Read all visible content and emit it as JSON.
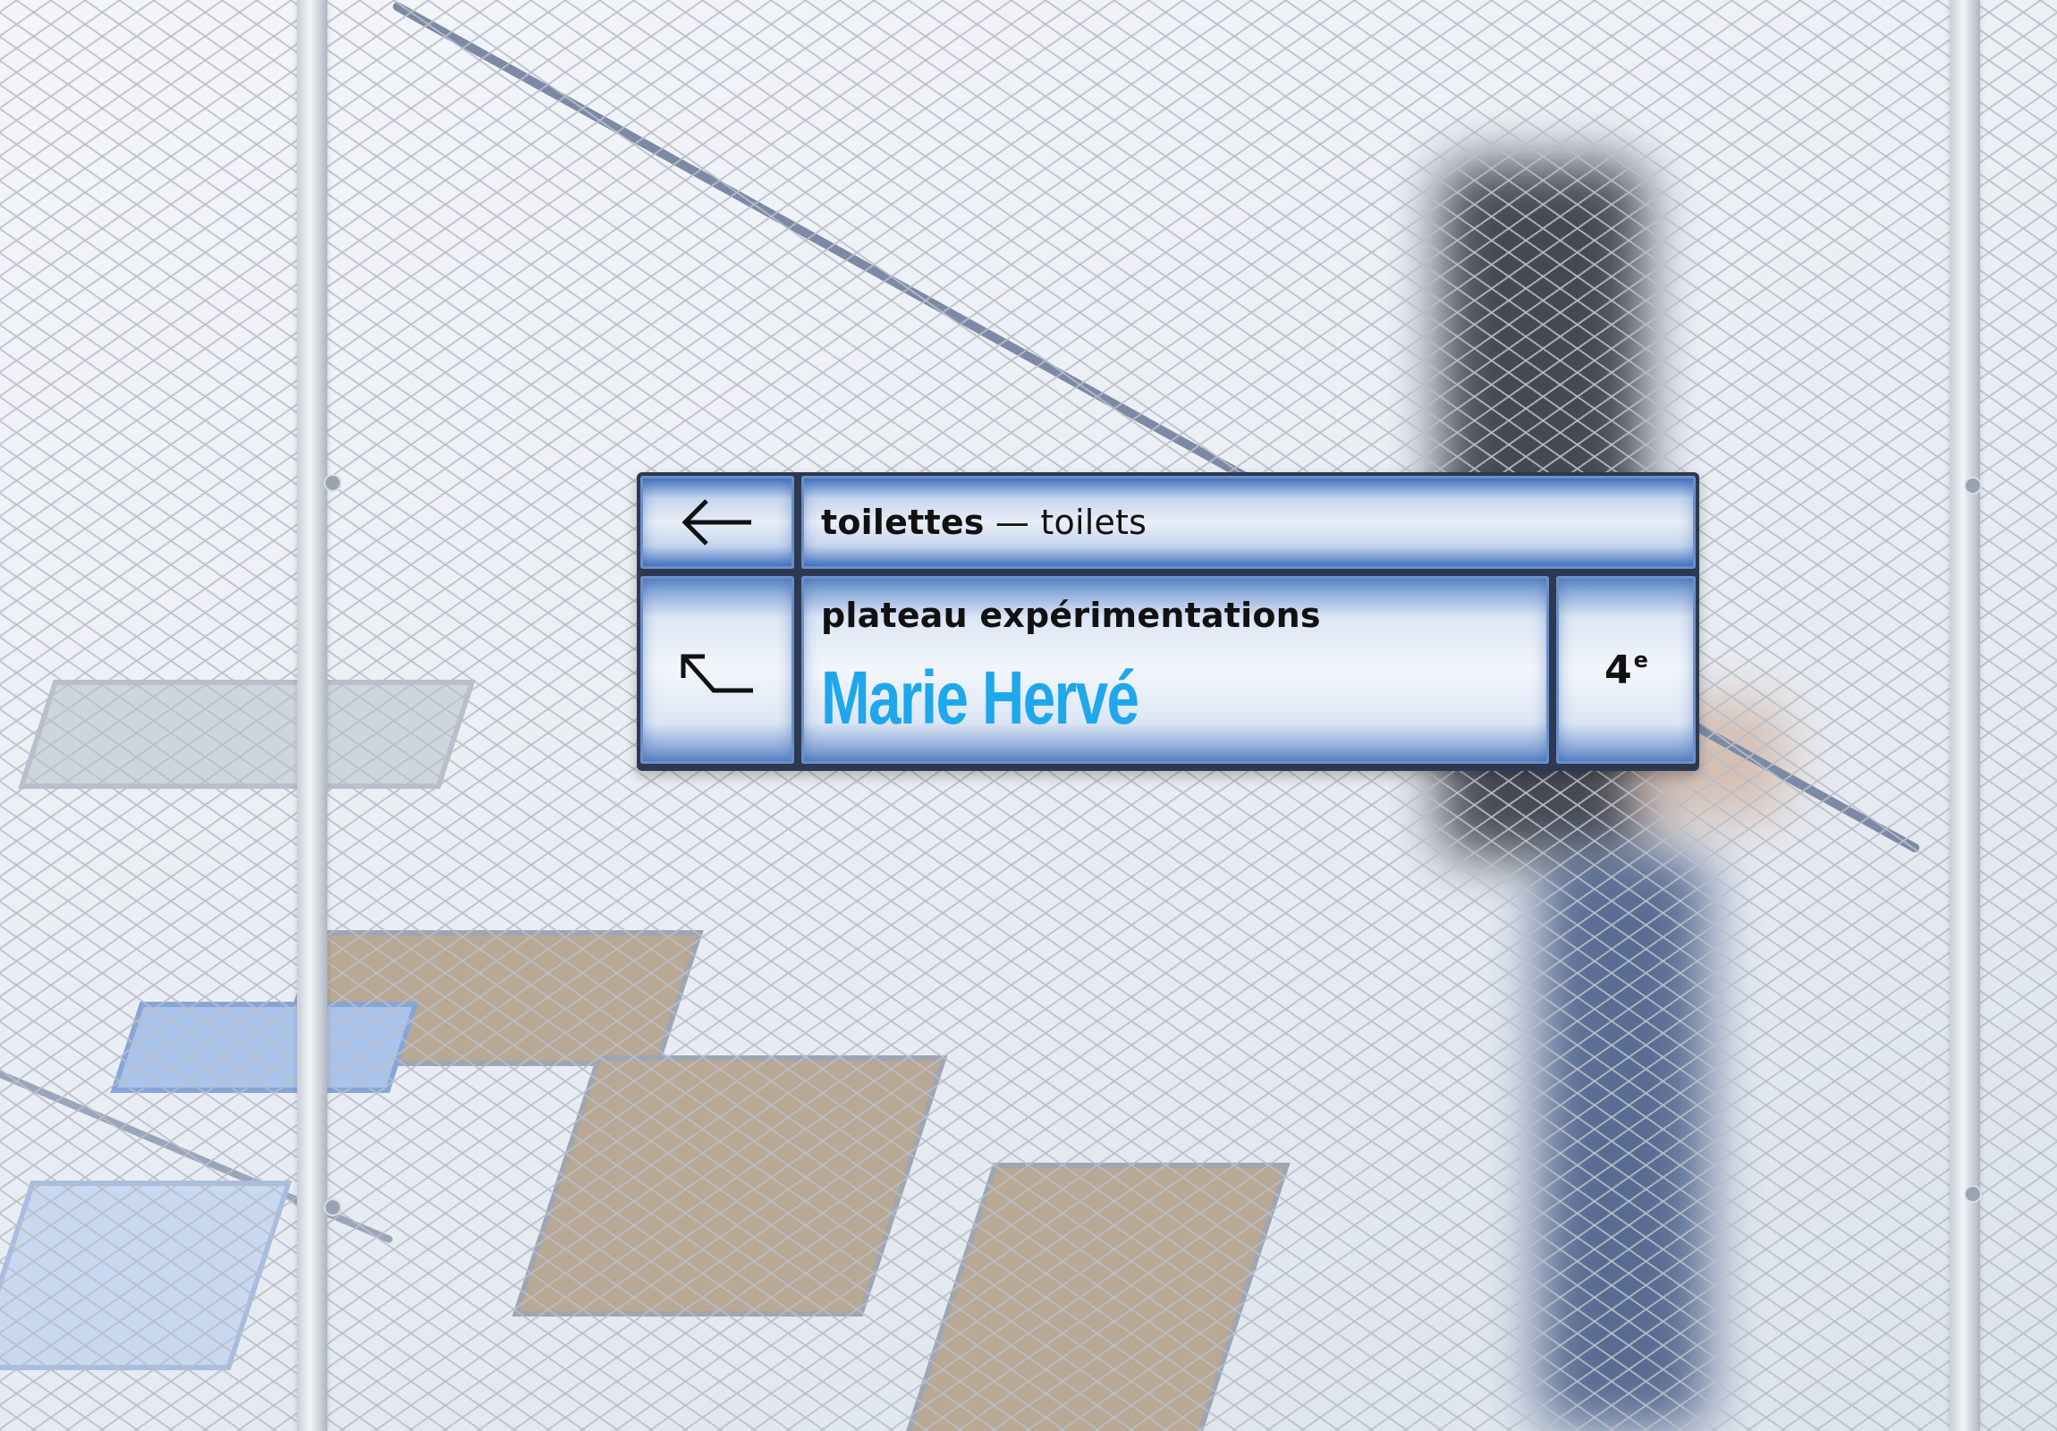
{
  "sign": {
    "row1": {
      "label_fr": "toilettes",
      "separator": " — ",
      "label_en": "toilets",
      "icon": "arrow-left-icon"
    },
    "row2": {
      "label": "plateau expérimentations",
      "name": "Marie Hervé",
      "icon": "arrow-up-left-icon"
    },
    "floor": {
      "number": "4",
      "suffix": "e"
    }
  },
  "colors": {
    "name_text": "#1fa7ec",
    "panel_blue": "#3f6fbf",
    "frame": "#2d3950"
  }
}
